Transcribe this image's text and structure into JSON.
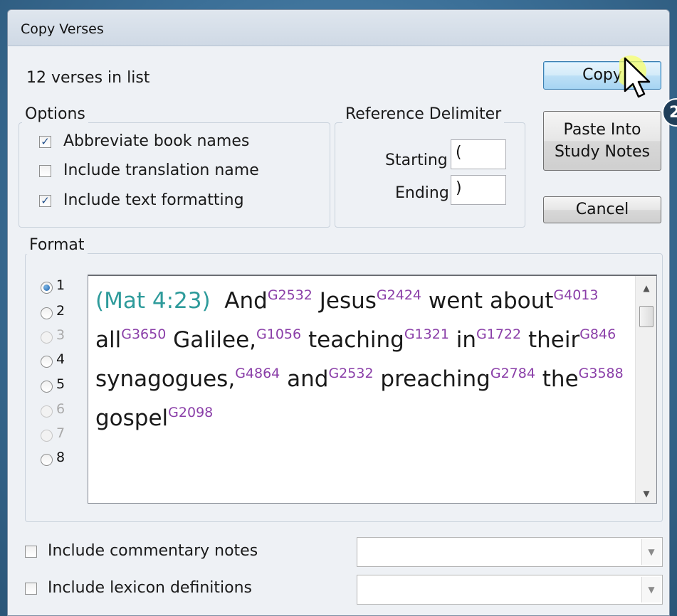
{
  "dialog": {
    "title": "Copy Verses",
    "verse_count": "12 verses in list"
  },
  "buttons": {
    "copy": "Copy",
    "paste_line1": "Paste Into",
    "paste_line2": "Study Notes",
    "cancel": "Cancel"
  },
  "options": {
    "legend": "Options",
    "abbreviate": {
      "label": "Abbreviate book names",
      "checked": true
    },
    "translation": {
      "label": "Include translation name",
      "checked": false
    },
    "formatting": {
      "label": "Include text formatting",
      "checked": true
    }
  },
  "delimiter": {
    "legend": "Reference Delimiter",
    "starting_label": "Starting",
    "starting_value": "(",
    "ending_label": "Ending",
    "ending_value": ")"
  },
  "format": {
    "legend": "Format",
    "selected": "1",
    "options": [
      {
        "label": "1",
        "enabled": true
      },
      {
        "label": "2",
        "enabled": true
      },
      {
        "label": "3",
        "enabled": false
      },
      {
        "label": "4",
        "enabled": true
      },
      {
        "label": "5",
        "enabled": true
      },
      {
        "label": "6",
        "enabled": false
      },
      {
        "label": "7",
        "enabled": false
      },
      {
        "label": "8",
        "enabled": true
      }
    ]
  },
  "preview": {
    "reference": "(Mat 4:23)",
    "words": [
      {
        "w": "And",
        "s": "G2532"
      },
      {
        "w": "Jesus",
        "s": "G2424"
      },
      {
        "w": "went about",
        "s": "G4013"
      },
      {
        "w": "all",
        "s": "G3650"
      },
      {
        "w": "Galilee,",
        "s": "G1056"
      },
      {
        "w": "teaching",
        "s": "G1321"
      },
      {
        "w": "in",
        "s": "G1722"
      },
      {
        "w": "their",
        "s": "G846"
      },
      {
        "w": "synagogues,",
        "s": "G4864"
      },
      {
        "w": "and",
        "s": "G2532"
      },
      {
        "w": "preaching",
        "s": "G2784"
      },
      {
        "w": "the",
        "s": "G3588"
      },
      {
        "w": "gospel",
        "s": "G2098"
      }
    ]
  },
  "bottom": {
    "commentary_label": "Include commentary notes",
    "lexicon_label": "Include lexicon definitions"
  },
  "annotation": {
    "badge": "2"
  }
}
